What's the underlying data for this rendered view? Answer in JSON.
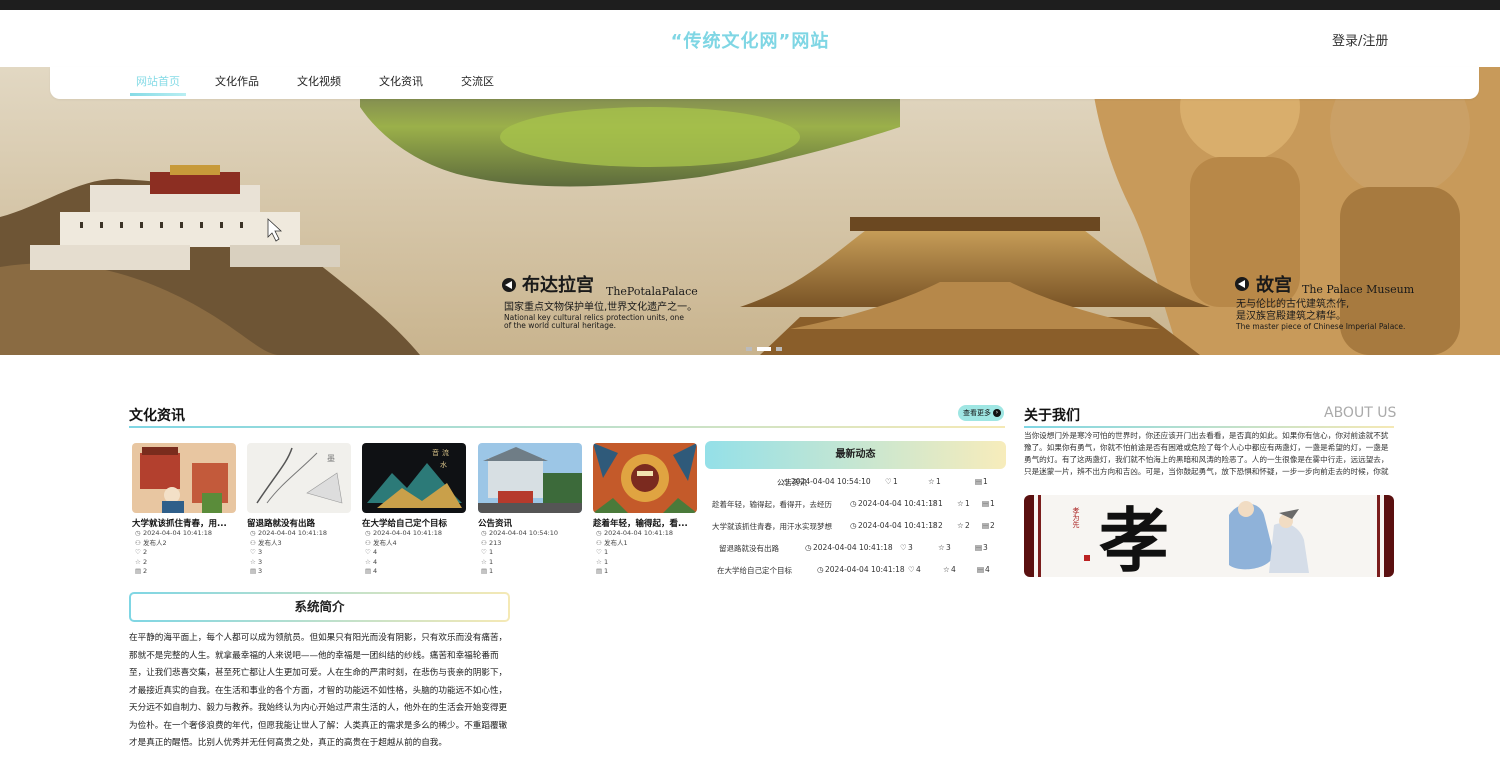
{
  "header": {
    "site_title": "“传统文化网”网站",
    "login": "登录/注册"
  },
  "nav": [
    {
      "label": "网站首页",
      "active": true
    },
    {
      "label": "文化作品"
    },
    {
      "label": "文化视频"
    },
    {
      "label": "文化资讯"
    },
    {
      "label": "交流区"
    }
  ],
  "banner": {
    "potala": {
      "cn": "布达拉宫",
      "en": "ThePotalaPalace",
      "desc_cn": "国家重点文物保护单位,世界文化遗产之一。",
      "desc_en1": "National key cultural relics protection units, one",
      "desc_en2": "of the world cultural heritage."
    },
    "museum": {
      "cn": "故宫",
      "en": "The Palace Museum",
      "desc_cn1": "无与伦比的古代建筑杰作,",
      "desc_cn2": "是汉族宫殿建筑之精华。",
      "desc_en": "The master piece of Chinese Imperial Palace."
    },
    "slide_count": 3,
    "active_slide": 2
  },
  "news": {
    "title": "文化资讯",
    "more": "查看更多",
    "cards": [
      {
        "title": "大学就该抓住青春，用...",
        "date": "2024-04-04 10:41:18",
        "author": "发布人2",
        "likes": "2",
        "collects": "2",
        "comments": "2"
      },
      {
        "title": "留退路就没有出路",
        "date": "2024-04-04 10:41:18",
        "author": "发布人3",
        "likes": "3",
        "collects": "3",
        "comments": "3"
      },
      {
        "title": "在大学给自己定个目标",
        "date": "2024-04-04 10:41:18",
        "author": "发布人4",
        "likes": "4",
        "collects": "4",
        "comments": "4"
      },
      {
        "title": "公告资讯",
        "date": "2024-04-04 10:54:10",
        "author": "213",
        "likes": "1",
        "collects": "1",
        "comments": "1"
      },
      {
        "title": "趁着年轻，输得起，看...",
        "date": "2024-04-04 10:41:18",
        "author": "发布人1",
        "likes": "1",
        "collects": "1",
        "comments": "1"
      }
    ],
    "card_art": [
      "音",
      "流",
      "水"
    ]
  },
  "latest": {
    "title": "最新动态",
    "rows": [
      {
        "title": "公告资讯",
        "date": "2024-04-04 10:54:10",
        "likes": "1",
        "collects": "1",
        "comments": "1"
      },
      {
        "title": "趁着年轻，输得起，看得开，去经历",
        "date": "2024-04-04 10:41:18",
        "likes": "1",
        "collects": "1",
        "comments": "1"
      },
      {
        "title": "大学就该抓住青春，用汗水实现梦想",
        "date": "2024-04-04 10:41:18",
        "likes": "2",
        "collects": "2",
        "comments": "2"
      },
      {
        "title": "留退路就没有出路",
        "date": "2024-04-04 10:41:18",
        "likes": "3",
        "collects": "3",
        "comments": "3"
      },
      {
        "title": "在大学给自己定个目标",
        "date": "2024-04-04 10:41:18",
        "likes": "4",
        "collects": "4",
        "comments": "4"
      }
    ]
  },
  "about": {
    "title": "关于我们",
    "title_en": "ABOUT US",
    "text": "当你设想门外是寒冷可怕的世界时，你还应该开门出去看看，是否真的如此。如果你有信心，你对前途就不犹豫了。如果你有勇气，你就不怕前途是否有困难或危险了每个人心中都应有两盏灯，一盏是希望的灯，一盏是勇气的灯。有了这两盏灯，我们就不怕海上的黑暗和风涛的险恶了。人的一生很像是在雾中行走，远远望去，只是迷蒙一片，辨不出方向和吉凶。可是，当你鼓起勇气，放下恐惧和怀疑，一步一步向前走去的时候，你就会发现，每走一步，你都能把下一步路看得清楚一点。“往前走，别站在...",
    "image_char": "孝",
    "image_small": "孝为先"
  },
  "intro": {
    "title": "系统简介",
    "text": "在平静的海平面上，每个人都可以成为领航员。但如果只有阳光而没有阴影，只有欢乐而没有痛苦，那就不是完整的人生。就拿最幸福的人来说吧——他的幸福是一团纠结的纱线。痛苦和幸福轮番而至，让我们悲喜交集，甚至死亡都让人生更加可爱。人在生命的严肃时刻，在悲伤与丧亲的阴影下，才最接近真实的自我。在生活和事业的各个方面，才智的功能远不如性格，头脑的功能远不如心性，天分远不如自制力、毅力与教养。我始终认为内心开始过严肃生活的人，他外在的生活会开始变得更为俭朴。在一个奢侈浪费的年代，但愿我能让世人了解：人类真正的需求是多么的稀少。不重蹈覆辙才是真正的醒悟。比别人优秀并无任何高贵之处，真正的高贵在于超越从前的自我。"
  }
}
